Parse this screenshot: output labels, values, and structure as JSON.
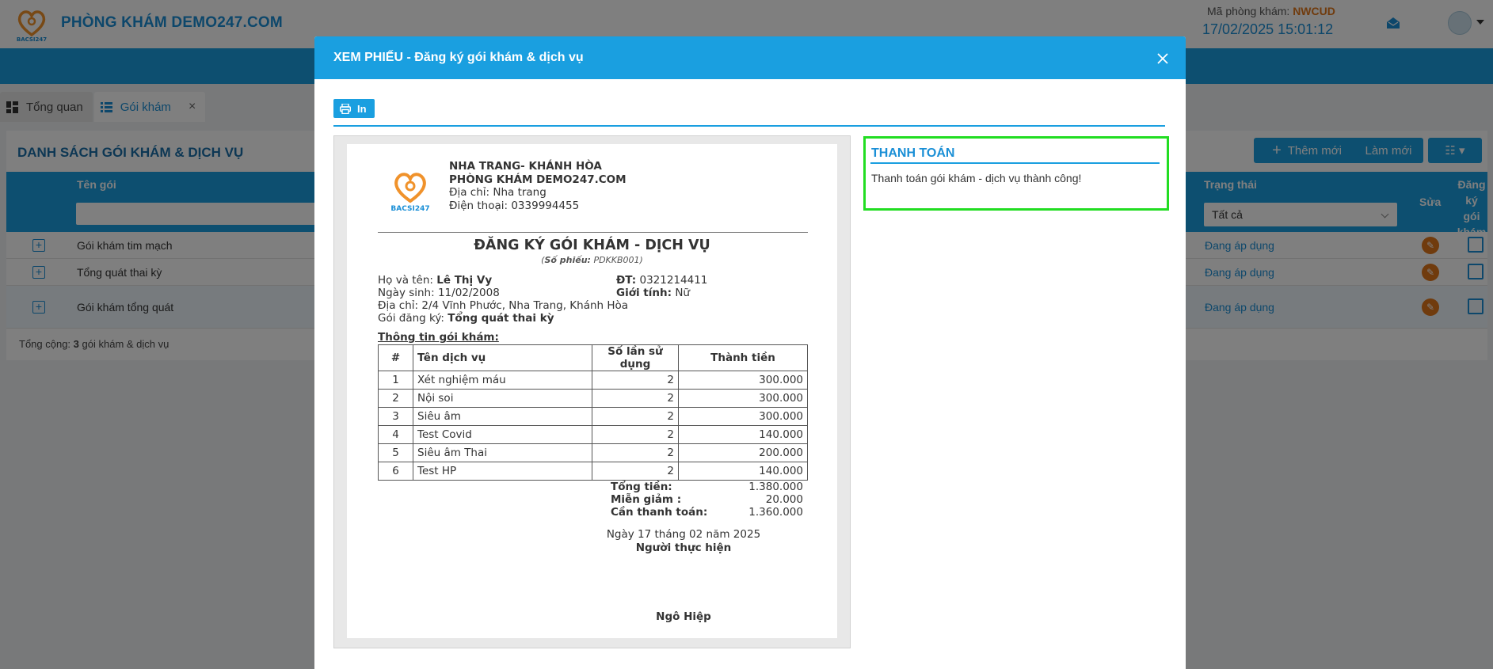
{
  "app": {
    "title": "PHÒNG KHÁM DEMO247.COM",
    "clinic_code_label": "Mã phòng khám:",
    "clinic_code": "NWCUD",
    "datetime": "17/02/2025 15:01:12",
    "logo_text": "BACSI247"
  },
  "tabs": [
    {
      "label": "Tổng quan"
    },
    {
      "label": "Gói khám"
    }
  ],
  "list": {
    "title": "DANH SÁCH GÓI KHÁM & DỊCH VỤ",
    "add_label": "Thêm mới",
    "refresh_label": "Làm mới",
    "columns": {
      "name": "Tên gói",
      "status": "Trạng thái",
      "edit": "Sửa",
      "register": "Đăng ký gói khám"
    },
    "status_filter": "Tất cả",
    "rows": [
      {
        "name": "Gói khám tim mạch",
        "status": "Đang áp dụng"
      },
      {
        "name": "Tổng quát thai kỳ",
        "status": "Đang áp dụng"
      },
      {
        "name": "Gói khám tổng quát",
        "status": "Đang áp dụng"
      }
    ],
    "total_prefix": "Tổng cộng:",
    "total_count": "3",
    "total_suffix": "gói khám & dịch vụ"
  },
  "modal": {
    "title": "XEM PHIẾU - Đăng ký gói khám & dịch vụ",
    "print_label": "In",
    "receipt": {
      "org_line1": "NHA TRANG- KHÁNH HÒA",
      "org_line2": "PHÒNG KHÁM DEMO247.COM",
      "address_line": "Địa chỉ: Nha trang",
      "phone_line": "Điện thoại: 0339994455",
      "title": "ĐĂNG KÝ GÓI KHÁM - DỊCH VỤ",
      "receipt_no_label": "Số phiếu:",
      "receipt_no": "PDKKB001",
      "name_label": "Họ và tên:",
      "name": "Lê Thị Vy",
      "phone_label": "ĐT:",
      "phone": "0321214411",
      "dob_label": "Ngày sinh:",
      "dob": "11/02/2008",
      "gender_label": "Giới tính:",
      "gender": "Nữ",
      "address_label": "Địa chỉ:",
      "address": "2/4 Vĩnh Phước, Nha Trang, Khánh Hòa",
      "package_label": "Gói đăng ký:",
      "package": "Tổng quát thai kỳ",
      "section_title": "Thông tin gói khám:",
      "table_headers": [
        "#",
        "Tên dịch vụ",
        "Số lần sử dụng",
        "Thành tiền"
      ],
      "services": [
        {
          "no": "1",
          "name": "Xét nghiệm máu",
          "times": "2",
          "amount": "300.000"
        },
        {
          "no": "2",
          "name": "Nội soi",
          "times": "2",
          "amount": "300.000"
        },
        {
          "no": "3",
          "name": "Siêu âm",
          "times": "2",
          "amount": "300.000"
        },
        {
          "no": "4",
          "name": "Test Covid",
          "times": "2",
          "amount": "140.000"
        },
        {
          "no": "5",
          "name": "Siêu âm Thai",
          "times": "2",
          "amount": "200.000"
        },
        {
          "no": "6",
          "name": "Test HP",
          "times": "2",
          "amount": "140.000"
        }
      ],
      "total_label": "Tổng tiền:",
      "total": "1.380.000",
      "discount_label": "Miễn giảm :",
      "discount": "20.000",
      "due_label": "Cần thanh toán:",
      "due": "1.360.000",
      "date_line": "Ngày 17 tháng 02 năm 2025",
      "performer_label": "Người thực hiện",
      "performer": "Ngô Hiệp"
    },
    "payment": {
      "title": "THANH TOÁN",
      "message": "Thanh toán gói khám - dịch vụ thành công!"
    }
  },
  "colors": {
    "primary": "#1a9fe0",
    "accent": "#e0761a",
    "highlight_border": "#22dd22"
  }
}
